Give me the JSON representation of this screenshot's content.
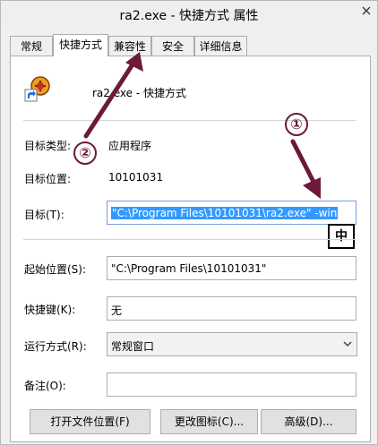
{
  "window": {
    "title": "ra2.exe - 快捷方式 属性"
  },
  "tabs": [
    {
      "label": "常规"
    },
    {
      "label": "快捷方式"
    },
    {
      "label": "兼容性"
    },
    {
      "label": "安全"
    },
    {
      "label": "详细信息"
    }
  ],
  "header": {
    "name": "ra2.exe - 快捷方式"
  },
  "fields": {
    "target_type": {
      "label": "目标类型:",
      "value": "应用程序"
    },
    "target_location": {
      "label": "目标位置:",
      "value": "10101031"
    },
    "target": {
      "label": "目标(T):",
      "value": "\"C:\\Program Files\\10101031\\ra2.exe\" -win"
    },
    "start_in": {
      "label": "起始位置(S):",
      "value": "\"C:\\Program Files\\10101031\""
    },
    "shortcut_key": {
      "label": "快捷键(K):",
      "value": "无"
    },
    "run": {
      "label": "运行方式(R):",
      "value": "常规窗口"
    },
    "comment": {
      "label": "备注(O):",
      "value": ""
    }
  },
  "ime_indicator": "中",
  "buttons": {
    "open_location": "打开文件位置(F)",
    "change_icon": "更改图标(C)...",
    "advanced": "高级(D)..."
  },
  "annotations": {
    "marker_1": "①",
    "marker_2": "②",
    "color": "#6b1a3a"
  }
}
